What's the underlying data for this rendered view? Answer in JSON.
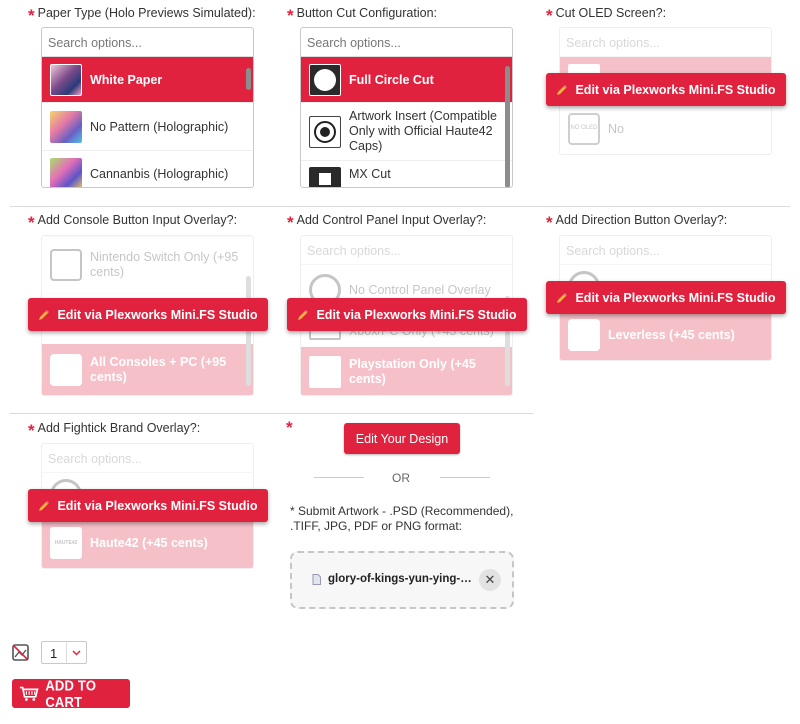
{
  "search_placeholder": "Search options...",
  "edit_label": "Edit via Plexworks Mini.FS Studio",
  "paper_type": {
    "label": "Paper Type (Holo Previews Simulated):",
    "options": [
      "White Paper",
      "No Pattern (Holographic)",
      "Cannanbis (Holographic)"
    ]
  },
  "button_cut": {
    "label": "Button Cut Configuration:",
    "options": [
      "Full Circle Cut",
      "Artwork Insert (Compatible Only with Official Haute42 Caps)",
      "MX Cut"
    ]
  },
  "oled": {
    "label": "Cut OLED Screen?:",
    "options": [
      "",
      "No"
    ],
    "thumb_text": "NO OLED"
  },
  "console_overlay": {
    "label": "Add Console Button Input Overlay?:",
    "options": [
      "Nintendo Switch Only (+95 cents)",
      "All Consoles + PC (+95 cents)"
    ]
  },
  "control_panel": {
    "label": "Add Control Panel Input Overlay?:",
    "options": [
      "No Control Panel Overlay",
      "Xbox/PC Only (+45 cents)",
      "Playstation Only (+45 cents)"
    ]
  },
  "direction_overlay": {
    "label": "Add Direction Button Overlay?:",
    "options": [
      "",
      "Leverless (+45 cents)"
    ]
  },
  "brand_overlay": {
    "label": "Add Fightick Brand Overlay?:",
    "options": [
      "",
      "Haute42 (+45 cents)"
    ],
    "thumb_text": "HAUTE42"
  },
  "design": {
    "edit_your_design": "Edit Your Design",
    "or": "OR",
    "submit_note": "* Submit Artwork - .PSD (Recommended), .TIFF, JPG, PDF or PNG format:",
    "file_name": "glory-of-kings-yun-ying-…"
  },
  "quantity": {
    "value": "1"
  },
  "add_to_cart": "ADD TO CART",
  "colors": {
    "accent": "#e0223f",
    "border": "#c9c9c9"
  }
}
